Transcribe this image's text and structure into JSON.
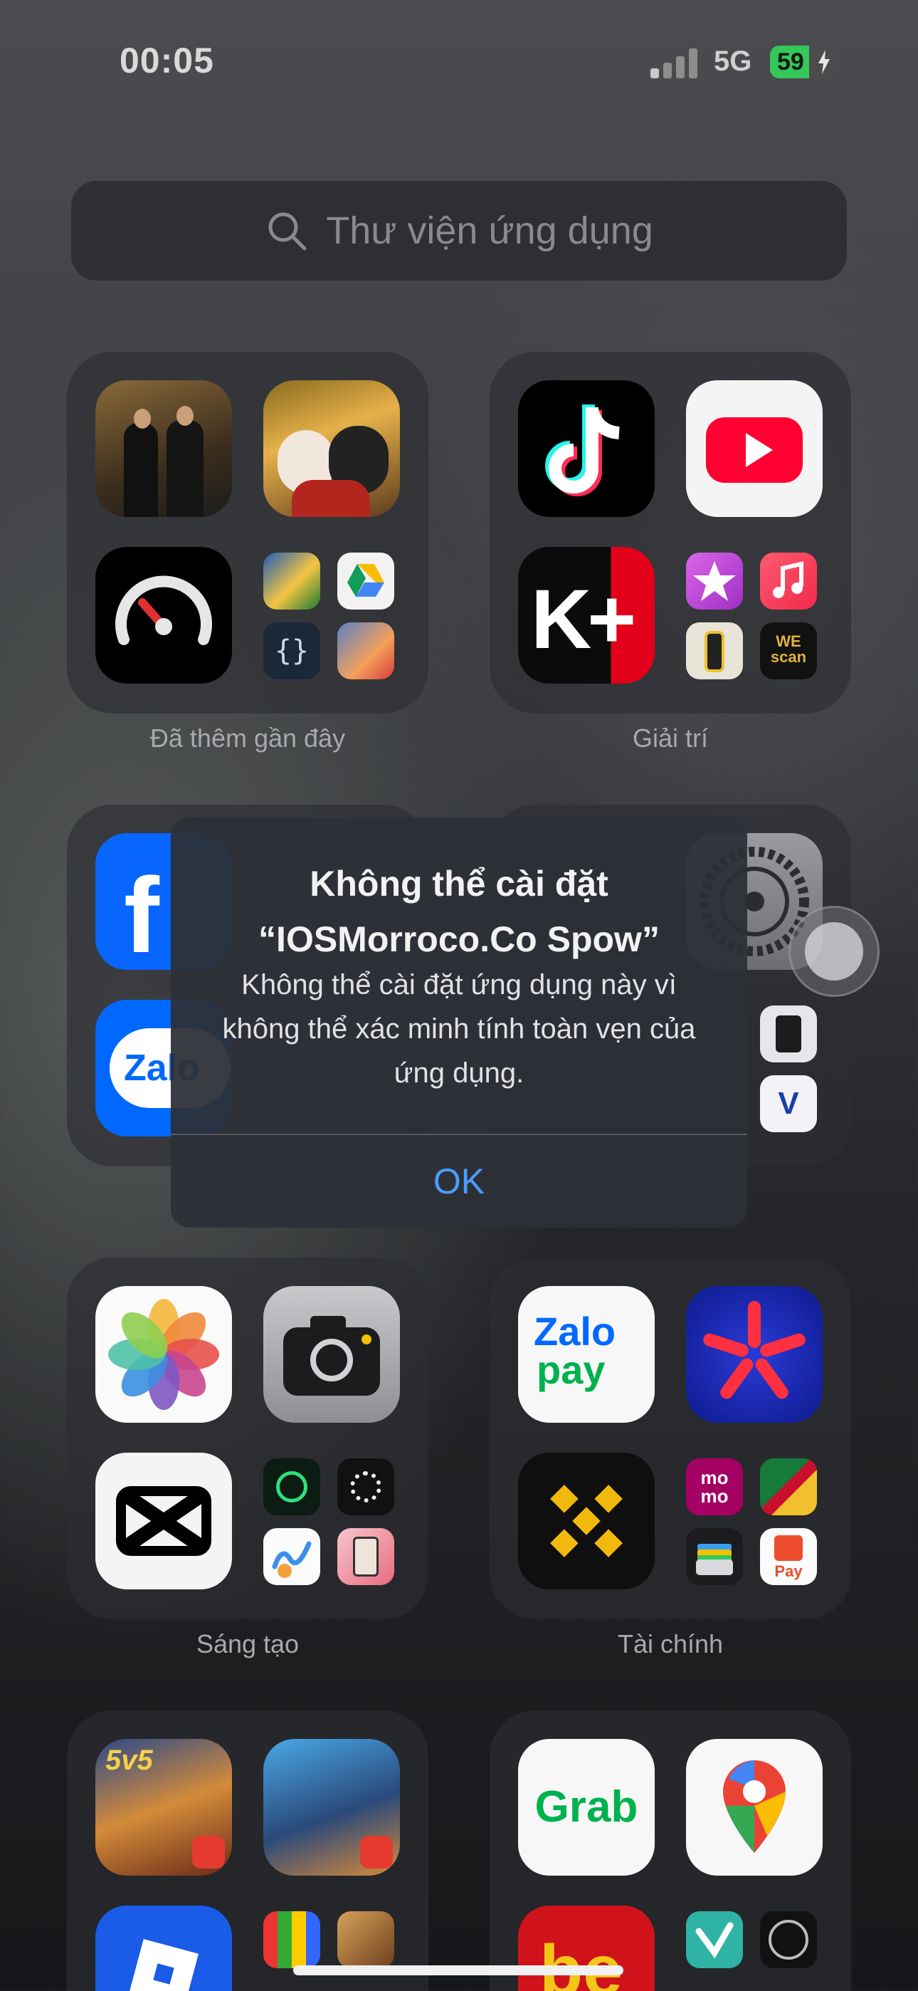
{
  "status_bar": {
    "time": "00:05",
    "network": "5G",
    "battery": "59",
    "battery_level": 0.59,
    "battery_color": "#34c759"
  },
  "search": {
    "placeholder": "Thư viện ứng dụng",
    "icon": "search-icon"
  },
  "folders": [
    {
      "label": "Đã thêm gần đây",
      "apps": [
        "photo-men-app",
        "kittens-app",
        "speedtest-icon",
        "football-game-app",
        "google-drive-icon",
        "code-braces-icon",
        "ff-game-app"
      ]
    },
    {
      "label": "Giải trí",
      "apps": [
        "tiktok-icon",
        "youtube-icon",
        "kplus-icon",
        "itunes-star-icon",
        "music-icon",
        "walkie-app",
        "wescan-app"
      ]
    },
    {
      "label": "Sáng tạo",
      "apps": [
        "photos-icon",
        "camera-icon",
        "capcut-icon",
        "player-app",
        "swirl-app",
        "freeform-app",
        "portrait-app"
      ]
    },
    {
      "label": "Tài chính",
      "apps": [
        "zalopay-icon",
        "star-app",
        "binance-icon",
        "momo-icon",
        "lottery-app",
        "wallet-icon",
        "shopeepay-icon"
      ]
    },
    {
      "label": "",
      "apps": [
        "lienquan-game-app",
        "freefire-app",
        "roblox-icon",
        "blocks-app",
        "clash-app"
      ]
    },
    {
      "label": "",
      "apps": [
        "grab-icon",
        "google-maps-icon",
        "be-icon",
        "vietjet-app",
        "speedometer-app"
      ]
    }
  ],
  "zalo_text": "Zalo",
  "zalopay": {
    "line1": "Zalo",
    "line2": "pay"
  },
  "shopeepay_text": "Pay",
  "momo_text": "mo mo",
  "wescan_text": "WE scan",
  "kplus_text": "K+",
  "grab_text": "Grab",
  "be_text": "be",
  "sv5_text": "5v5",
  "dialog": {
    "title_line1": "Không thể cài đặt",
    "title_line2": "“IOSMorroco.Co Spow”",
    "message": "Không thể cài đặt ứng dụng này vì không thể xác minh tính toàn vẹn của ứng dụng.",
    "ok_label": "OK",
    "accent": "#4b9dff"
  }
}
